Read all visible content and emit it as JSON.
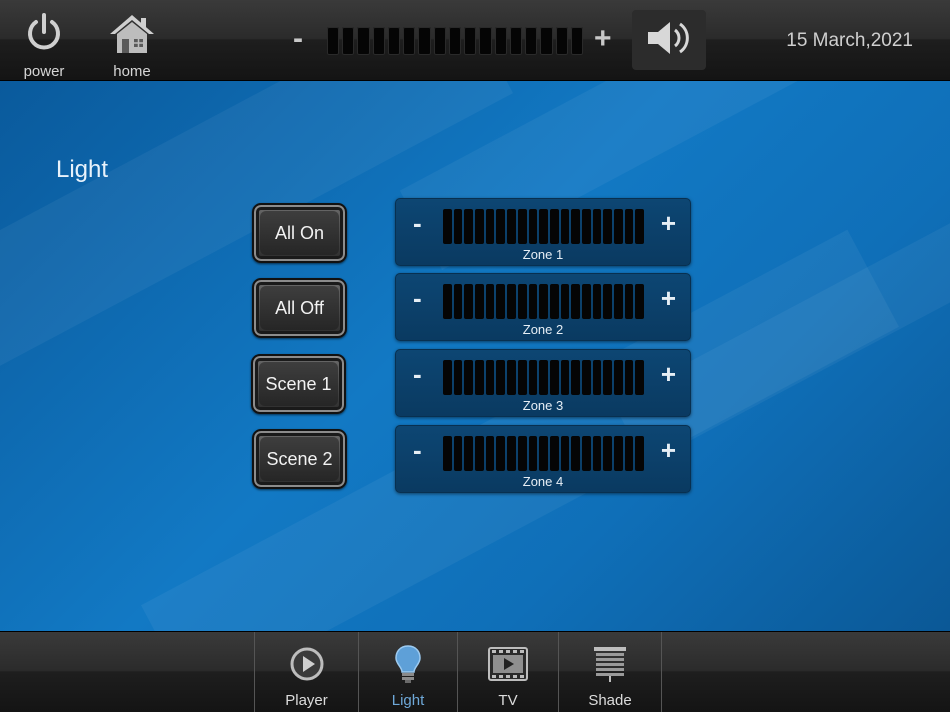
{
  "header": {
    "power_label": "power",
    "home_label": "home",
    "volume_minus": "-",
    "volume_plus": "+",
    "volume_segments": 17,
    "speaker_icon": "speaker-icon",
    "date": "15 March,2021"
  },
  "page": {
    "title": "Light"
  },
  "scenes": [
    {
      "label": "All On"
    },
    {
      "label": "All Off"
    },
    {
      "label": "Scene 1"
    },
    {
      "label": "Scene 2"
    }
  ],
  "zones": [
    {
      "label": "Zone 1",
      "minus": "-",
      "plus": "+"
    },
    {
      "label": "Zone 2",
      "minus": "-",
      "plus": "+"
    },
    {
      "label": "Zone 3",
      "minus": "-",
      "plus": "+"
    },
    {
      "label": "Zone 4",
      "minus": "-",
      "plus": "+"
    }
  ],
  "zone_segments": 19,
  "tabs": [
    {
      "label": "Player",
      "icon": "play-icon",
      "active": false
    },
    {
      "label": "Light",
      "icon": "lightbulb-icon",
      "active": true
    },
    {
      "label": "TV",
      "icon": "film-icon",
      "active": false
    },
    {
      "label": "Shade",
      "icon": "blinds-icon",
      "active": false
    }
  ],
  "colors": {
    "background_blue": "#1279c4",
    "zone_panel": "#0d4673",
    "active_tab": "#6ea8d8"
  }
}
